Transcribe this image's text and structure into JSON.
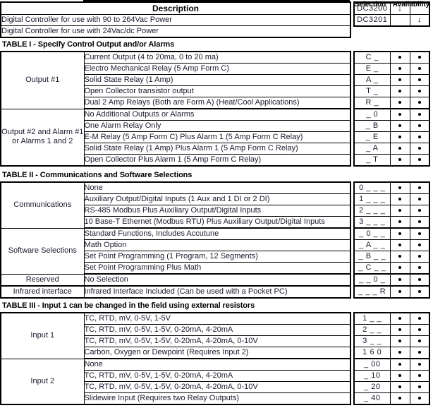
{
  "header": {
    "description_header": "Description",
    "selection_caption": "Selection",
    "availability_caption": "Availability",
    "arrow_glyph": "↓",
    "rows": [
      {
        "description": "Digital Controller for use with 90 to 264Vac Power",
        "selection": "DC3200",
        "avail1": "↓",
        "avail2": ""
      },
      {
        "description": "Digital Controller for use with 24Vac/dc Power",
        "selection": "DC3201",
        "avail1": "",
        "avail2": "↓"
      }
    ]
  },
  "tables": [
    {
      "title": "TABLE I - Specify Control Output and/or Alarms",
      "groups": [
        {
          "label": "Output #1",
          "rows": [
            {
              "description": "Current Output  (4 to 20ma, 0 to 20 ma)",
              "selection": "C _",
              "avail1": "•",
              "avail2": "•"
            },
            {
              "description": "Electro Mechanical Relay (5 Amp Form C)",
              "selection": "E _",
              "avail1": "•",
              "avail2": "•"
            },
            {
              "description": "Solid State Relay (1 Amp)",
              "selection": "A _",
              "avail1": "•",
              "avail2": "•"
            },
            {
              "description": "Open Collector transistor output",
              "selection": "T _",
              "avail1": "•",
              "avail2": "•"
            },
            {
              "description": "Dual 2 Amp Relays (Both are Form A) (Heat/Cool Applications)",
              "selection": "R _",
              "avail1": "•",
              "avail2": "•"
            }
          ]
        },
        {
          "label": "Output #2 and Alarm #1 or Alarms 1 and 2",
          "rows": [
            {
              "description": "No Additional Outputs or Alarms",
              "selection": "_ 0",
              "avail1": "•",
              "avail2": "•"
            },
            {
              "description": "One Alarm Relay Only",
              "selection": "_ B",
              "avail1": "•",
              "avail2": "•"
            },
            {
              "description": "E-M Relay (5 Amp Form C) Plus Alarm 1 (5 Amp Form C Relay)",
              "selection": "_ E",
              "avail1": "•",
              "avail2": "•"
            },
            {
              "description": "Solid State Relay (1 Amp) Plus  Alarm 1 (5 Amp Form C Relay)",
              "selection": "_ A",
              "avail1": "•",
              "avail2": "•"
            },
            {
              "description": "Open Collector Plus Alarm 1 (5 Amp Form C Relay)",
              "selection": "_ T",
              "avail1": "•",
              "avail2": "•"
            }
          ]
        }
      ]
    },
    {
      "title": "TABLE II - Communications and Software Selections",
      "groups": [
        {
          "label": "Communications",
          "rows": [
            {
              "description": "None",
              "selection": "0 _ _ _",
              "avail1": "•",
              "avail2": "•"
            },
            {
              "description": "Auxiliary Output/Digital Inputs  (1 Aux and 1 DI or 2 DI)",
              "selection": "1 _ _ _",
              "avail1": "•",
              "avail2": "•"
            },
            {
              "description": "RS-485 Modbus Plus Auxiliary Output/Digital Inputs",
              "selection": "2 _ _ _",
              "avail1": "•",
              "avail2": "•"
            },
            {
              "description": "10 Base-T Ethernet (Modbus RTU) Plus Auxiliary Output/Digital Inputs",
              "selection": "3 _ _ _",
              "avail1": "•",
              "avail2": "•"
            }
          ]
        },
        {
          "label": "Software Selections",
          "rows": [
            {
              "description": "Standard Functions, Includes Accutune",
              "selection": "_ 0 _ _",
              "avail1": "•",
              "avail2": "•"
            },
            {
              "description": "Math Option",
              "selection": "_ A _ _",
              "avail1": "•",
              "avail2": "•"
            },
            {
              "description": "Set Point Programming (1 Program, 12 Segments)",
              "selection": "_ B _ _",
              "avail1": "•",
              "avail2": "•"
            },
            {
              "description": "Set Point Programming Plus Math",
              "selection": "_ C _ _",
              "avail1": "•",
              "avail2": "•"
            }
          ]
        },
        {
          "label": "Reserved",
          "rows": [
            {
              "description": "No Selection",
              "selection": "_ _ 0 _",
              "avail1": "•",
              "avail2": "•"
            }
          ]
        },
        {
          "label": "Infrared interface",
          "rows": [
            {
              "description": "Infrared Interface Included (Can be used with a Pocket PC)",
              "selection": "_ _ _ R",
              "avail1": "•",
              "avail2": "•"
            }
          ]
        }
      ]
    },
    {
      "title": "TABLE III - Input 1 can be changed in the field using external resistors",
      "groups": [
        {
          "label": "Input 1",
          "rows": [
            {
              "description": "TC, RTD, mV, 0-5V, 1-5V",
              "selection": "1 _ _",
              "avail1": "•",
              "avail2": "•"
            },
            {
              "description": "TC, RTD, mV, 0-5V, 1-5V, 0-20mA, 4-20mA",
              "selection": "2 _ _",
              "avail1": "•",
              "avail2": "•"
            },
            {
              "description": "TC, RTD, mV, 0-5V, 1-5V, 0-20mA, 4-20mA, 0-10V",
              "selection": "3 _ _",
              "avail1": "•",
              "avail2": "•"
            },
            {
              "description": "Carbon, Oxygen or Dewpoint (Requires Input 2)",
              "selection": "1 6 0",
              "avail1": "•",
              "avail2": "•"
            }
          ]
        },
        {
          "label": "Input 2",
          "rows": [
            {
              "description": "None",
              "selection": "_ 00",
              "avail1": "•",
              "avail2": "•"
            },
            {
              "description": "TC, RTD, mV, 0-5V, 1-5V, 0-20mA, 4-20mA",
              "selection": "_ 10",
              "avail1": "•",
              "avail2": "•"
            },
            {
              "description": "TC, RTD, mV, 0-5V, 1-5V, 0-20mA, 4-20mA, 0-10V",
              "selection": "_ 20",
              "avail1": "•",
              "avail2": "•"
            },
            {
              "description": "Slidewire Input (Requires two Relay Outputs)",
              "selection": "_ 40",
              "avail1": "•",
              "avail2": "•"
            }
          ]
        }
      ]
    }
  ]
}
